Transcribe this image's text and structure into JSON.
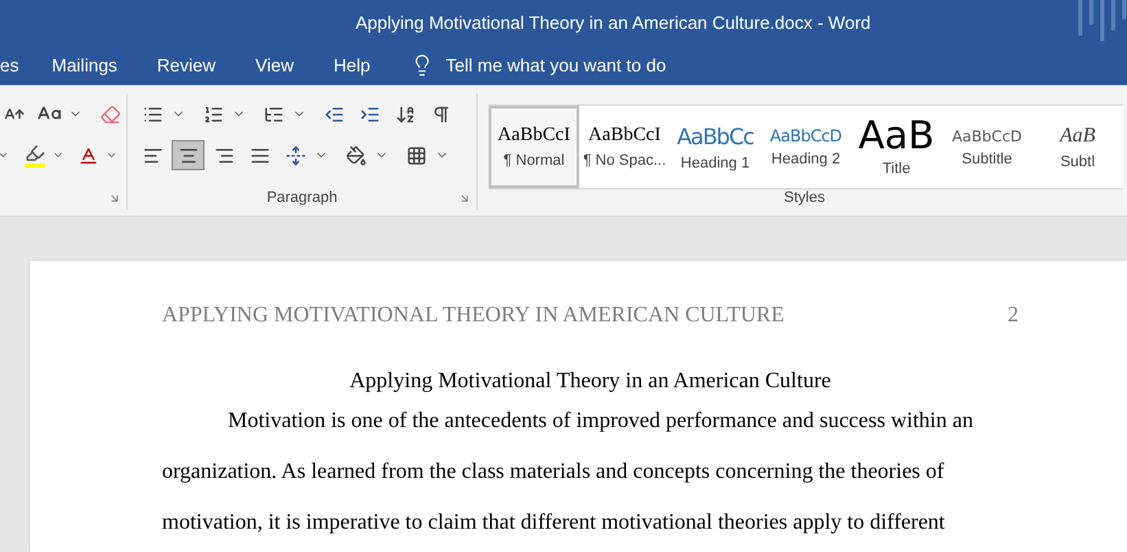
{
  "window": {
    "title": "Applying Motivational Theory in an American Culture.docx  -  Word"
  },
  "tabs": [
    {
      "label": "es",
      "selected": false
    },
    {
      "label": "Mailings",
      "selected": false
    },
    {
      "label": "Review",
      "selected": false
    },
    {
      "label": "View",
      "selected": false
    },
    {
      "label": "Help",
      "selected": false
    }
  ],
  "tell_me": {
    "placeholder": "Tell me what you want to do"
  },
  "paragraph_group": {
    "label": "Paragraph",
    "alignment": [
      {
        "kind": "left",
        "selected": false
      },
      {
        "kind": "center",
        "selected": true
      },
      {
        "kind": "right",
        "selected": false
      },
      {
        "kind": "justify",
        "selected": false
      }
    ]
  },
  "styles_group": {
    "label": "Styles",
    "items": [
      {
        "kind": "normal",
        "sample": "AaBbCcI",
        "label": "¶ Normal",
        "selected": true
      },
      {
        "kind": "nospacing",
        "sample": "AaBbCcI",
        "label": "¶ No Spac...",
        "selected": false
      },
      {
        "kind": "heading1",
        "sample": "AaBbCc",
        "label": "Heading 1",
        "selected": false
      },
      {
        "kind": "heading2",
        "sample": "AaBbCcD",
        "label": "Heading 2",
        "selected": false
      },
      {
        "kind": "title",
        "sample": "AaB",
        "label": "Title",
        "selected": false
      },
      {
        "kind": "subtitle",
        "sample": "AaBbCcD",
        "label": "Subtitle",
        "selected": false
      },
      {
        "kind": "emphasis",
        "sample": "AaB",
        "label": "Subtl",
        "selected": false
      }
    ]
  },
  "document": {
    "header": "APPLYING MOTIVATIONAL THEORY IN AMERICAN CULTURE",
    "page_number": "2",
    "title": "Applying Motivational Theory in an American Culture",
    "paragraph": "Motivation is one of the antecedents of improved performance and success within an organization. As learned from the class materials and concepts concerning the theories of motivation, it is imperative to claim that different motivational theories apply to different"
  }
}
